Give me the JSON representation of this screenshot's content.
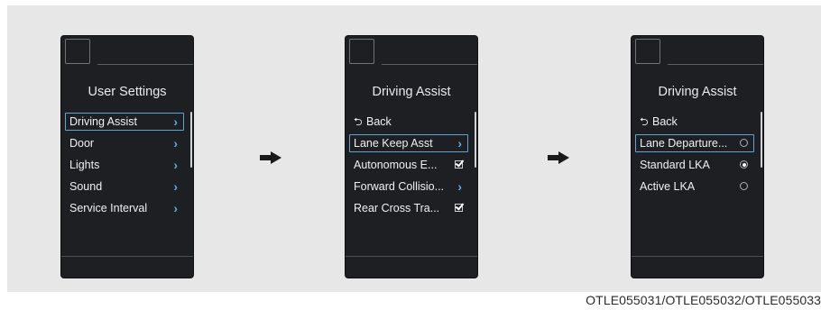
{
  "screens": [
    {
      "title": "User Settings",
      "items": [
        {
          "label": "Driving Assist",
          "control": "chevron",
          "selected": true
        },
        {
          "label": "Door",
          "control": "chevron"
        },
        {
          "label": "Lights",
          "control": "chevron"
        },
        {
          "label": "Sound",
          "control": "chevron"
        },
        {
          "label": "Service Interval",
          "control": "chevron"
        }
      ]
    },
    {
      "title": "Driving Assist",
      "back_label": "Back",
      "items": [
        {
          "label": "Lane Keep Asst",
          "control": "chevron",
          "selected": true
        },
        {
          "label": "Autonomous E...",
          "control": "checkbox",
          "checked": true
        },
        {
          "label": "Forward Collisio...",
          "control": "chevron"
        },
        {
          "label": "Rear Cross Tra...",
          "control": "checkbox",
          "checked": true
        }
      ]
    },
    {
      "title": "Driving Assist",
      "back_label": "Back",
      "items": [
        {
          "label": "Lane Departure...",
          "control": "radio",
          "selected": true,
          "on": false
        },
        {
          "label": "Standard LKA",
          "control": "radio",
          "on": true
        },
        {
          "label": "Active LKA",
          "control": "radio",
          "on": false
        }
      ]
    }
  ],
  "caption": "OTLE055031/OTLE055032/OTLE055033",
  "colors": {
    "accent": "#4db2ea",
    "selection_border": "#5aa8d6",
    "screen_bg": "#1d1f22"
  }
}
